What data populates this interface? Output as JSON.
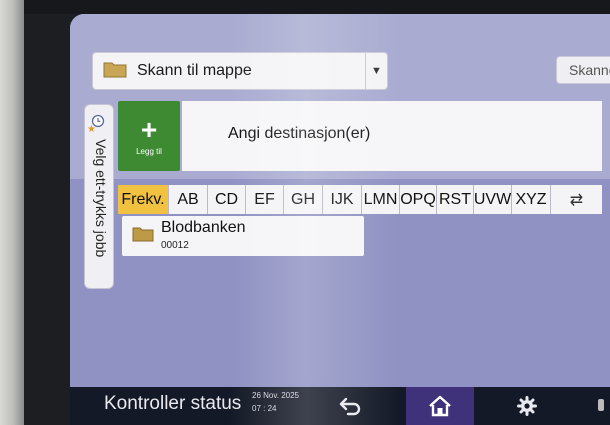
{
  "header": {
    "mode_label": "Skann til mappe",
    "scan_tab_label": "Skanne"
  },
  "side_tab": {
    "label": "Velg ett-trykks jobb"
  },
  "destination": {
    "add_label": "Legg til",
    "placeholder": "Angi destinasjon(er)"
  },
  "tabs": [
    {
      "label": "Frekv."
    },
    {
      "label": "AB"
    },
    {
      "label": "CD"
    },
    {
      "label": "EF"
    },
    {
      "label": "GH"
    },
    {
      "label": "IJK"
    },
    {
      "label": "LMN"
    },
    {
      "label": "OPQ"
    },
    {
      "label": "RST"
    },
    {
      "label": "UVW"
    },
    {
      "label": "XYZ"
    }
  ],
  "list": [
    {
      "name": "Blodbanken",
      "number": "00012"
    }
  ],
  "bottom_bar": {
    "status_label": "Kontroller status",
    "date": "26 Nov. 2025",
    "time": "07 : 24"
  },
  "colors": {
    "accent_active_tab": "#f1c141",
    "add_button": "#3e8a33",
    "home_button": "#3f327a",
    "screen_background": "#8f92c2"
  }
}
